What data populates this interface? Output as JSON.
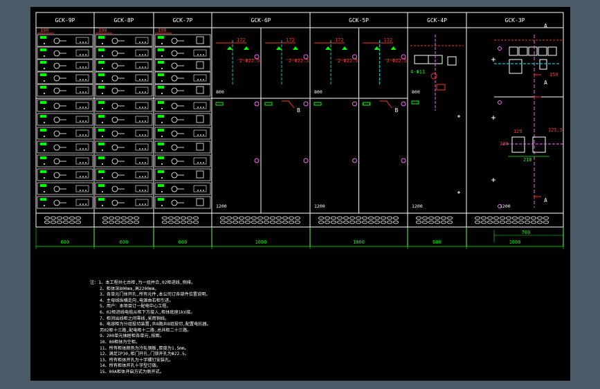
{
  "cabinets": [
    {
      "name": "GCK-9P",
      "width_label": "600",
      "dim_label": "190",
      "type": "drawer"
    },
    {
      "name": "GCK-8P",
      "width_label": "600",
      "dim_label": "190",
      "type": "drawer"
    },
    {
      "name": "GCK-7P",
      "width_label": "600",
      "dim_label": "190",
      "type": "drawer"
    },
    {
      "name": "GCK-6P",
      "width_label": "1000",
      "type": "open"
    },
    {
      "name": "GCK-5P",
      "width_label": "1000",
      "type": "open"
    },
    {
      "name": "GCK-4P",
      "width_label": "600",
      "type": "capacitor"
    },
    {
      "name": "GCK-3P",
      "width_label": "1000",
      "type": "incoming"
    }
  ],
  "labels": {
    "section_a": "A",
    "section_b": "B",
    "height_top": "800",
    "height_bottom": "1200",
    "hole_size": "2-Φ22.5",
    "dim_700": "700",
    "dim_129": "129",
    "dim_121": "121.5",
    "dim_218": "218",
    "dim_120": "120",
    "dim_150": "150"
  },
  "notes": [
    "注：1、本工程共七台柜,为一组并合,02柜进线,侧排。",
    "2、柜体深800mm,高2200mm。",
    "3、各单元门体开孔,所有元件,本公司订各部件位置说明。",
    "4、主母线纵横走向,电源由右柜引进。",
    "5、用户：本项目订一配电中心工程。",
    "6、02柜进线电缆从柜下方接入,柜体底座1kV接。",
    "7、柜间出线柜之间零线,采用铜线。",
    "8、电容柜为分组投切装置,共8路共8组投切,配置电抗器。",
    "另02柜十三路,配电柜十二路,总共柜二十三路。",
    "9、200单元抽屉柜各单元,按图。",
    "10、00柜体为空柜。",
    "11、所有柜体颜色为冷轧钢板,厚度为1.5mm。",
    "12、满足IP30,柜门开孔,门锁开孔为Φ22.5。",
    "13、所有柜体开孔为十字螺钉安装孔。",
    "14、所有柜体开孔十字型订做。",
    "15、00A柜体开启方式为侧开式。"
  ]
}
